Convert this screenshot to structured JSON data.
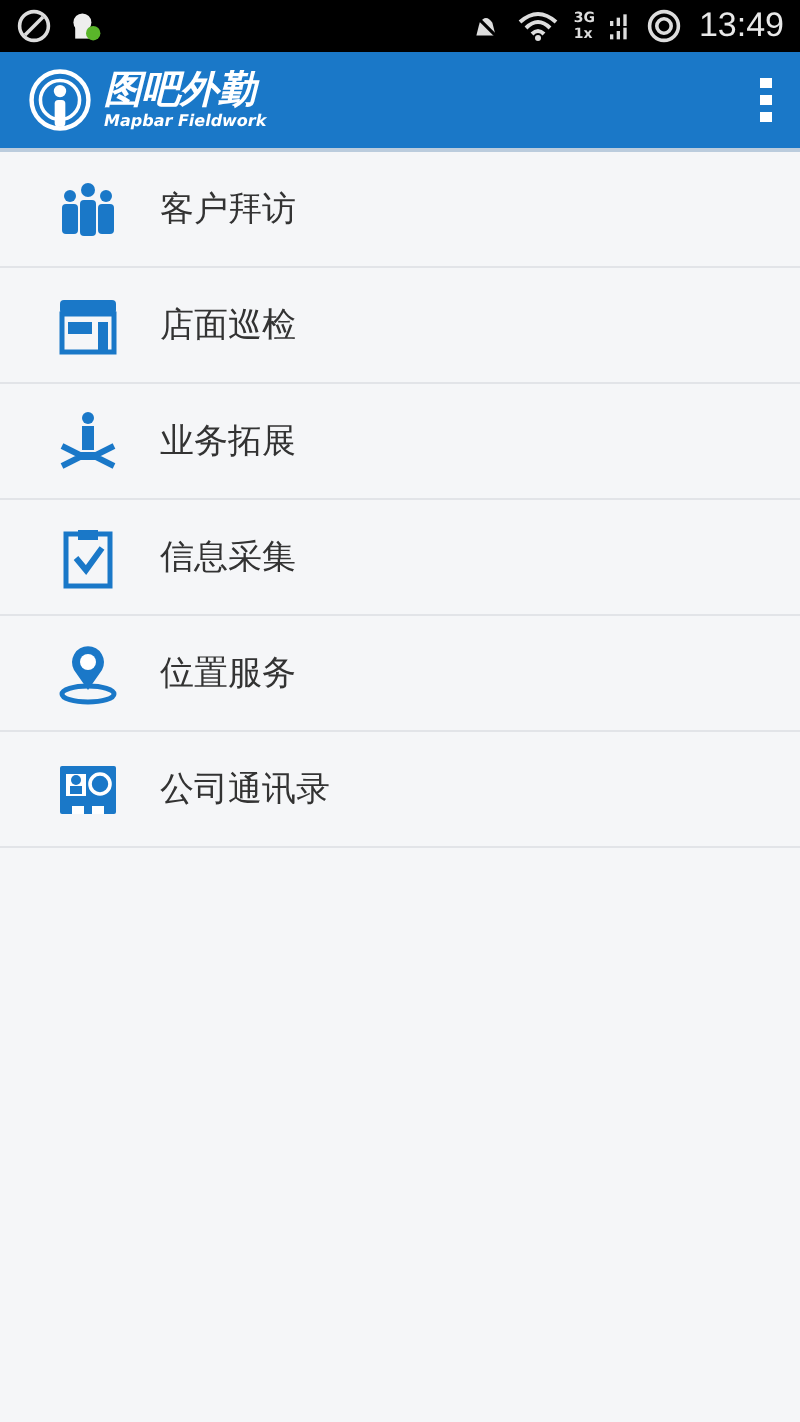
{
  "status_bar": {
    "network_top": "3G",
    "network_bottom": "1x",
    "time": "13:49"
  },
  "app_bar": {
    "title": "图吧外勤",
    "subtitle": "Mapbar Fieldwork"
  },
  "menu_items": [
    {
      "label": "客户拜访",
      "kind": "people"
    },
    {
      "label": "店面巡检",
      "kind": "store"
    },
    {
      "label": "业务拓展",
      "kind": "expand"
    },
    {
      "label": "信息采集",
      "kind": "clipboard"
    },
    {
      "label": "位置服务",
      "kind": "location"
    },
    {
      "label": "公司通讯录",
      "kind": "contacts"
    }
  ]
}
